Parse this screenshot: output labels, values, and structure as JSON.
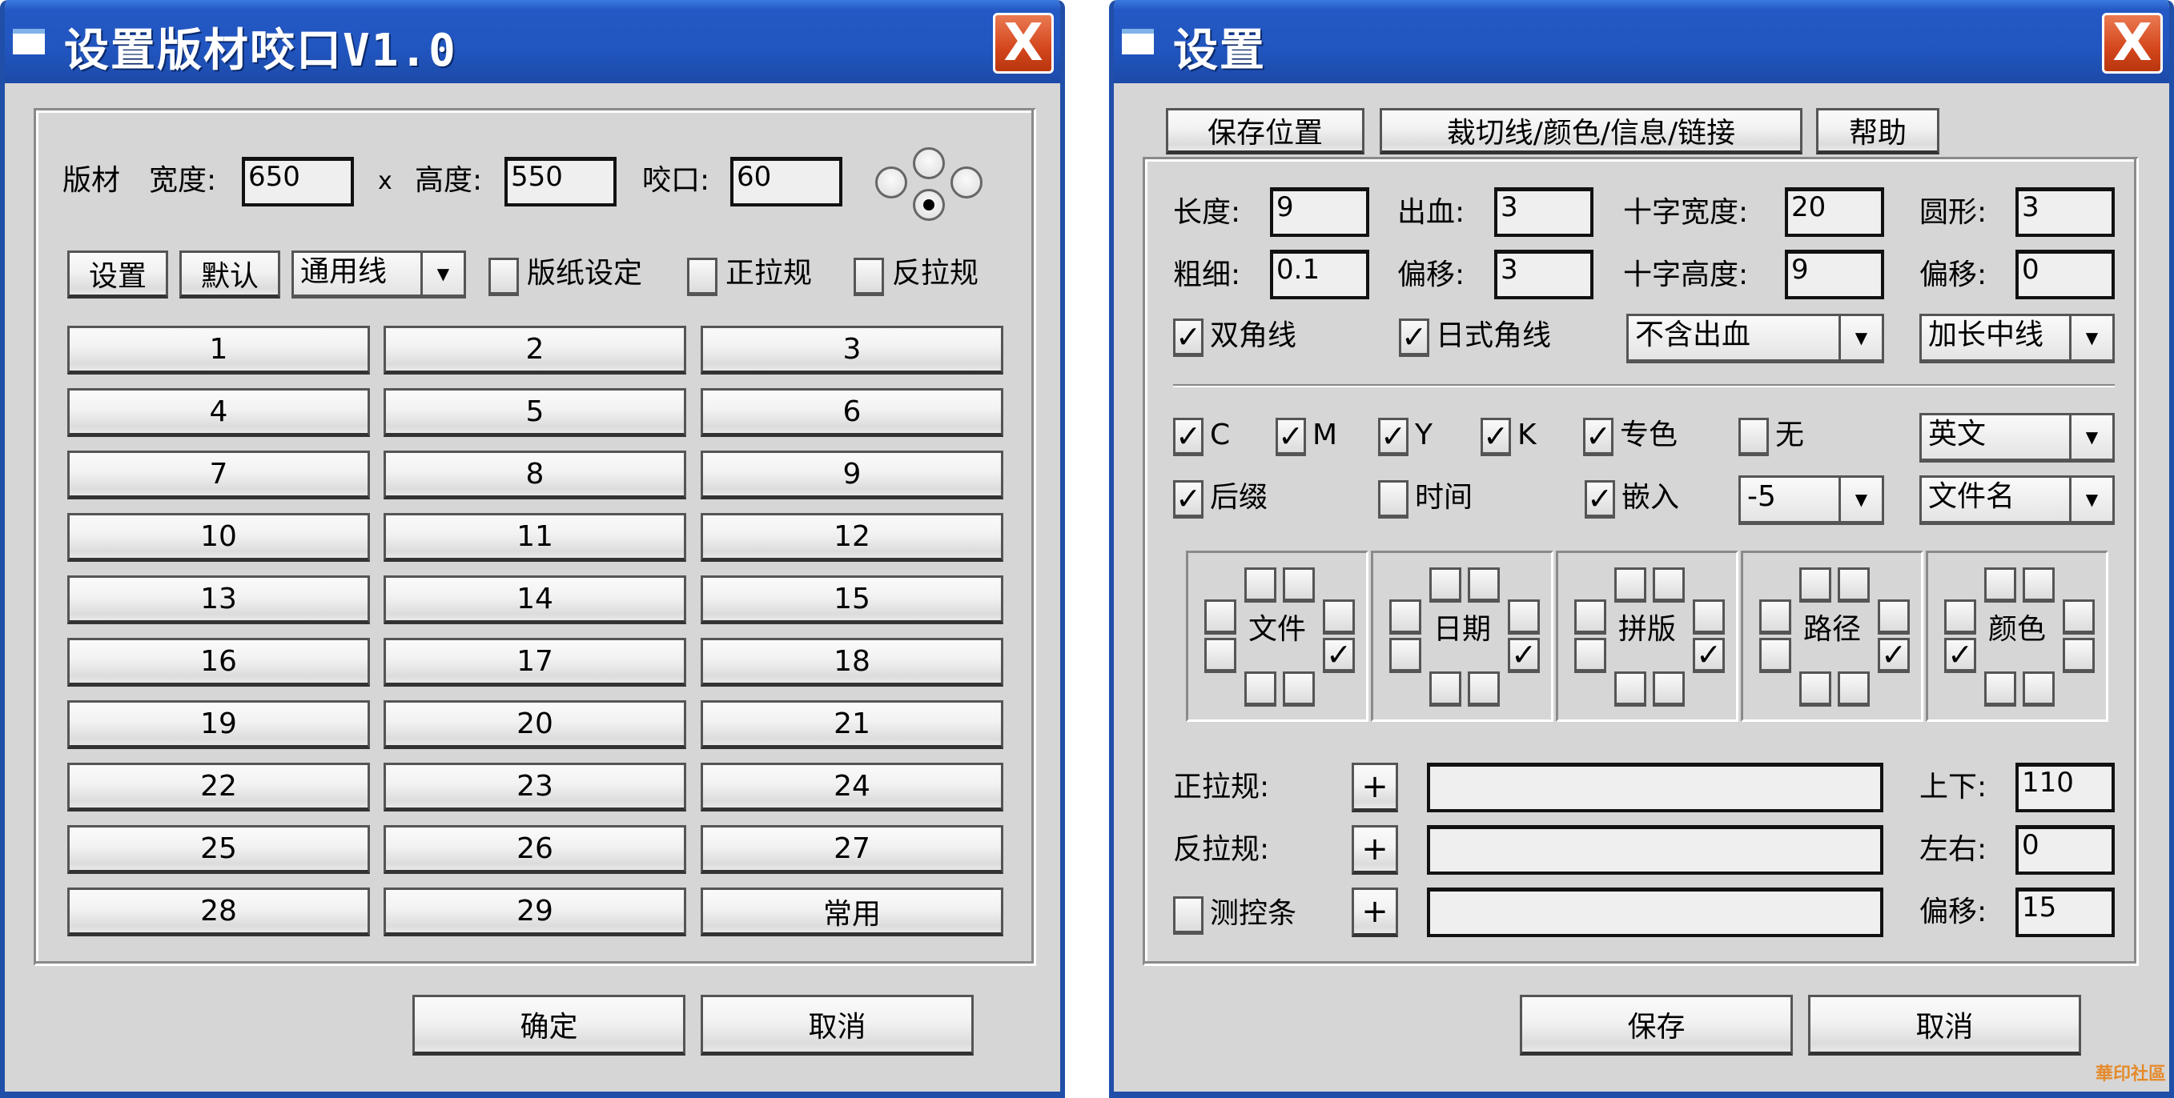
{
  "left_window": {
    "title": "设置版材咬口V1.0",
    "close_label": "X",
    "row1": {
      "plate_label": "版材",
      "width_label": "宽度:",
      "width_value": "650",
      "x_label": "x",
      "height_label": "高度:",
      "height_value": "550",
      "gripper_label": "咬口:",
      "gripper_value": "60"
    },
    "radio_positions": [
      {
        "name": "top",
        "selected": false
      },
      {
        "name": "left",
        "selected": false
      },
      {
        "name": "right",
        "selected": false
      },
      {
        "name": "bottom",
        "selected": true
      }
    ],
    "row2": {
      "settings_button": "设置",
      "default_button": "默认",
      "line_type_select": "通用线",
      "paper_setting_checkbox": {
        "label": "版纸设定",
        "checked": false
      },
      "front_guide_checkbox": {
        "label": "正拉规",
        "checked": false
      },
      "back_guide_checkbox": {
        "label": "反拉规",
        "checked": false
      }
    },
    "preset_buttons": [
      "1",
      "2",
      "3",
      "4",
      "5",
      "6",
      "7",
      "8",
      "9",
      "10",
      "11",
      "12",
      "13",
      "14",
      "15",
      "16",
      "17",
      "18",
      "19",
      "20",
      "21",
      "22",
      "23",
      "24",
      "25",
      "26",
      "27",
      "28",
      "29",
      "常用"
    ],
    "ok_button": "确定",
    "cancel_button": "取消"
  },
  "right_window": {
    "title": "设置",
    "close_label": "X",
    "top_buttons": {
      "save_position": "保存位置",
      "crop_tab": "裁切线/颜色/信息/链接",
      "help": "帮助"
    },
    "fields": {
      "length_label": "长度:",
      "length_value": "9",
      "bleed_label": "出血:",
      "bleed_value": "3",
      "cross_width_label": "十字宽度:",
      "cross_width_value": "20",
      "circle_label": "圆形:",
      "circle_value": "3",
      "thickness_label": "粗细:",
      "thickness_value": "0.1",
      "offset1_label": "偏移:",
      "offset1_value": "3",
      "cross_height_label": "十字高度:",
      "cross_height_value": "9",
      "offset2_label": "偏移:",
      "offset2_value": "0"
    },
    "double_corner": {
      "label": "双角线",
      "checked": true
    },
    "japanese_corner": {
      "label": "日式角线",
      "checked": true
    },
    "bleed_select": "不含出血",
    "center_line_select": "加长中线",
    "color_checks": [
      {
        "label": "C",
        "checked": true
      },
      {
        "label": "M",
        "checked": true
      },
      {
        "label": "Y",
        "checked": true
      },
      {
        "label": "K",
        "checked": true
      },
      {
        "label": "专色",
        "checked": true
      },
      {
        "label": "无",
        "checked": false
      }
    ],
    "language_select": "英文",
    "suffix_check": {
      "label": "后缀",
      "checked": true
    },
    "time_check": {
      "label": "时间",
      "checked": false
    },
    "embed_check": {
      "label": "嵌入",
      "checked": true
    },
    "embed_offset_select": "-5",
    "filename_select": "文件名",
    "position_groups": [
      {
        "label": "文件",
        "checked": [
          "right-bottom"
        ]
      },
      {
        "label": "日期",
        "checked": [
          "right-bottom"
        ]
      },
      {
        "label": "拼版",
        "checked": [
          "right-bottom"
        ]
      },
      {
        "label": "路径",
        "checked": [
          "right-bottom"
        ]
      },
      {
        "label": "颜色",
        "checked": [
          "left-bottom"
        ]
      }
    ],
    "guides": {
      "front_label": "正拉规:",
      "back_label": "反拉规:",
      "control_strip": {
        "label": "测控条",
        "checked": false
      },
      "add_label": "+",
      "front_path": "",
      "back_path": "",
      "strip_path": "",
      "updown_label": "上下:",
      "updown_value": "110",
      "leftright_label": "左右:",
      "leftright_value": "0",
      "offset_label": "偏移:",
      "offset_value": "15"
    },
    "save_button": "保存",
    "cancel_button": "取消"
  },
  "watermark": "華印社區",
  "colors": {
    "titlebar": "#2155bf",
    "close": "#d4461c",
    "dialog_bg": "#d6d6d6"
  }
}
